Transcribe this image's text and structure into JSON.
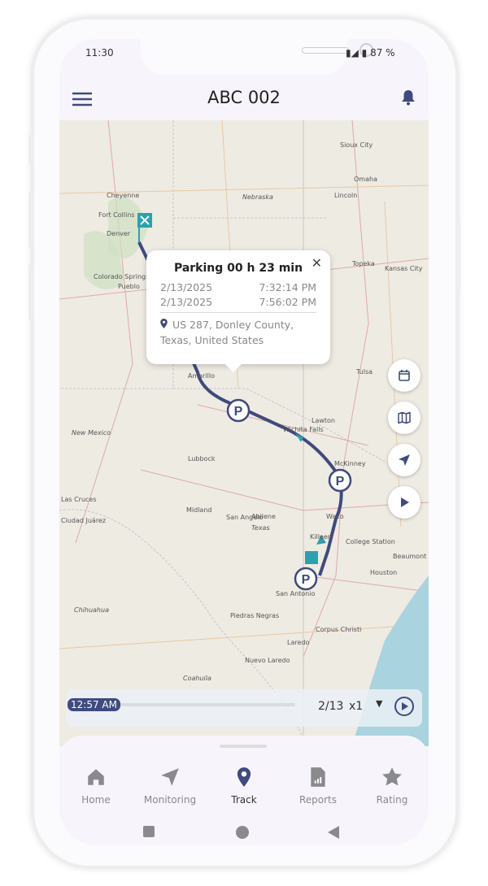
{
  "status_bar": {
    "time": "11:30",
    "battery": "87 %"
  },
  "header": {
    "title": "ABC 002",
    "menu_icon": "hamburger-icon",
    "bell_icon": "bell-icon"
  },
  "map": {
    "labels": [
      "Sioux City",
      "Nebraska",
      "Omaha",
      "Lincoln",
      "Cheyenne",
      "Fort Collins",
      "Denver",
      "Colorado Springs",
      "Pueblo",
      "Kansas City",
      "Topeka",
      "Tulsa",
      "Amarillo",
      "Lubbock",
      "Wichita Falls",
      "McKinney",
      "Abilene",
      "Midland",
      "San Angelo",
      "Waco",
      "Killeen",
      "College Station",
      "Houston",
      "San Antonio",
      "Corpus Christi",
      "Laredo",
      "Nuevo Laredo",
      "Ciudad Juárez",
      "Las Cruces",
      "New Mexico",
      "Texas",
      "Beaumont",
      "Chihuahua",
      "Coahuila",
      "Lawton",
      "Piedras Negras"
    ],
    "route_color": "#3f4a7e",
    "arrow_color": "#2ba1b0"
  },
  "popup": {
    "title": "Parking 00 h 23 min",
    "start_date": "2/13/2025",
    "start_time": "7:32:14 PM",
    "end_date": "2/13/2025",
    "end_time": "7:56:02 PM",
    "address": "US 287, Donley County, Texas, United States"
  },
  "player": {
    "time": "12:57 AM",
    "position": "2/13",
    "speed": "x1"
  },
  "nav": [
    {
      "label": "Home",
      "icon": "home-icon"
    },
    {
      "label": "Monitoring",
      "icon": "navigation-icon"
    },
    {
      "label": "Track",
      "icon": "location-pin-icon",
      "active": true
    },
    {
      "label": "Reports",
      "icon": "report-icon"
    },
    {
      "label": "Rating",
      "icon": "star-icon"
    }
  ],
  "colors": {
    "accent": "#3f4a7e",
    "inactive": "#888888"
  }
}
